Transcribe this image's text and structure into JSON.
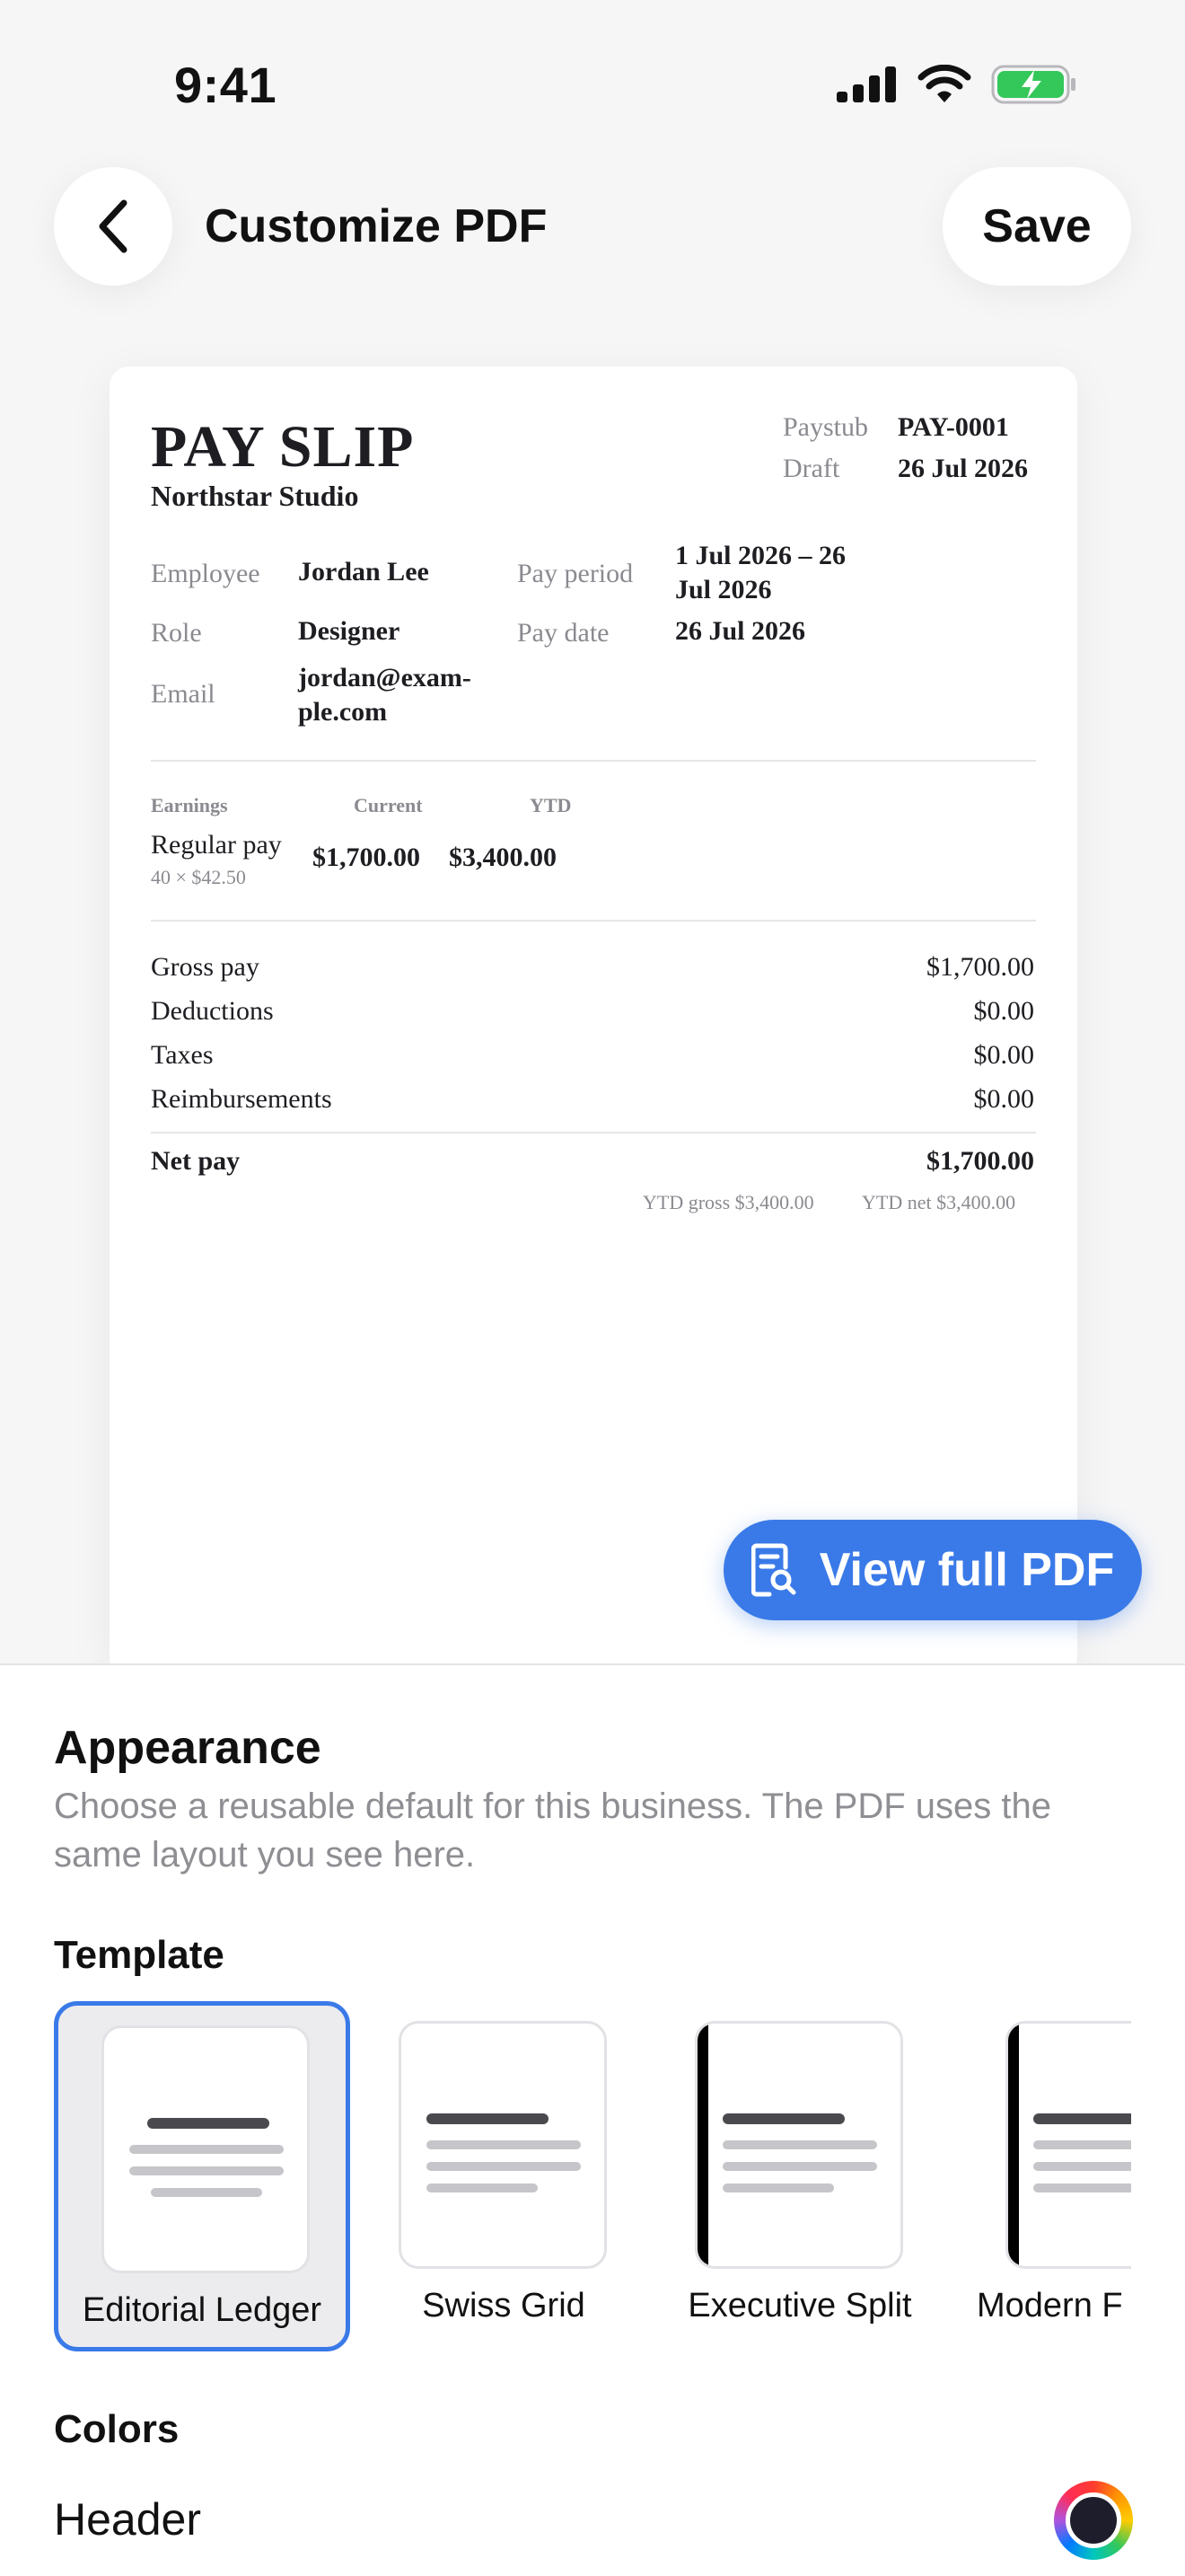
{
  "status_bar": {
    "time": "9:41"
  },
  "nav": {
    "title": "Customize PDF",
    "save_label": "Save"
  },
  "payslip": {
    "title": "PAY SLIP",
    "company": "Northstar Studio",
    "meta": [
      {
        "label": "Paystub",
        "value": "PAY-0001"
      },
      {
        "label": "Draft",
        "value": "26 Jul 2026"
      }
    ],
    "employee": {
      "employee_label": "Employee",
      "employee_value": "Jordan Lee",
      "role_label": "Role",
      "role_value": "Designer",
      "email_label": "Email",
      "email_value_line1": "jordan@exam-",
      "email_value_line2": "ple.com",
      "period_label": "Pay period",
      "period_value_line1": "1 Jul 2026 – 26",
      "period_value_line2": "Jul 2026",
      "date_label": "Pay date",
      "date_value": "26 Jul 2026"
    },
    "earnings": {
      "headers": {
        "name": "Earnings",
        "current": "Current",
        "ytd": "YTD"
      },
      "rows": [
        {
          "name": "Regular pay",
          "detail": "40 × $42.50",
          "current": "$1,700.00",
          "ytd": "$3,400.00"
        }
      ]
    },
    "summary": [
      {
        "label": "Gross pay",
        "value": "$1,700.00"
      },
      {
        "label": "Deductions",
        "value": "$0.00"
      },
      {
        "label": "Taxes",
        "value": "$0.00"
      },
      {
        "label": "Reimbursements",
        "value": "$0.00"
      }
    ],
    "net": {
      "label": "Net pay",
      "value": "$1,700.00"
    },
    "ytd_gross": "YTD gross $3,400.00",
    "ytd_net": "YTD net $3,400.00"
  },
  "view_pdf_label": "View full PDF",
  "appearance": {
    "title": "Appearance",
    "description": "Choose a reusable default for this business. The PDF uses the same layout you see here.",
    "template_title": "Template",
    "templates": [
      {
        "name": "Editorial Ledger",
        "selected": true,
        "side_bar": false
      },
      {
        "name": "Swiss Grid",
        "selected": false,
        "side_bar": false
      },
      {
        "name": "Executive Split",
        "selected": false,
        "side_bar": true
      },
      {
        "name": "Modern F",
        "selected": false,
        "side_bar": true
      }
    ],
    "colors_title": "Colors",
    "header_label": "Header"
  },
  "colors": {
    "accent": "#3a7ae8",
    "battery": "#34c759",
    "header_color": "#1d1d2b"
  }
}
